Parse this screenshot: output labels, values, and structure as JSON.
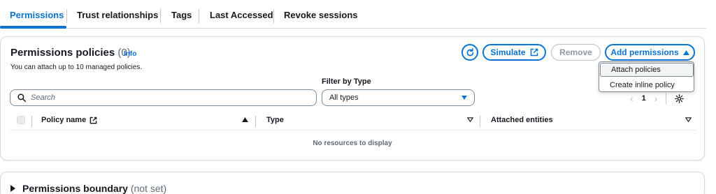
{
  "tabs": [
    {
      "label": "Permissions",
      "active": true
    },
    {
      "label": "Trust relationships"
    },
    {
      "label": "Tags"
    },
    {
      "label": "Last Accessed"
    },
    {
      "label": "Revoke sessions"
    }
  ],
  "policies": {
    "title": "Permissions policies",
    "count": "(0)",
    "info": "Info",
    "description": "You can attach up to 10 managed policies.",
    "buttons": {
      "refresh_icon": "refresh-icon",
      "simulate": "Simulate",
      "remove": "Remove",
      "add": "Add permissions"
    },
    "filter_label": "Filter by Type",
    "search_placeholder": "Search",
    "type_select_value": "All types",
    "pagination": {
      "current_page": "1"
    },
    "columns": [
      "Policy name",
      "Type",
      "Attached entities"
    ],
    "empty_text": "No resources to display"
  },
  "add_permissions_menu": [
    "Attach policies",
    "Create inline policy"
  ],
  "boundary": {
    "title": "Permissions boundary",
    "status": "(not set)"
  },
  "colors": {
    "accent": "#0972d3",
    "text": "#16191f",
    "muted": "#5f6b7a",
    "border": "#d5dbdb"
  }
}
